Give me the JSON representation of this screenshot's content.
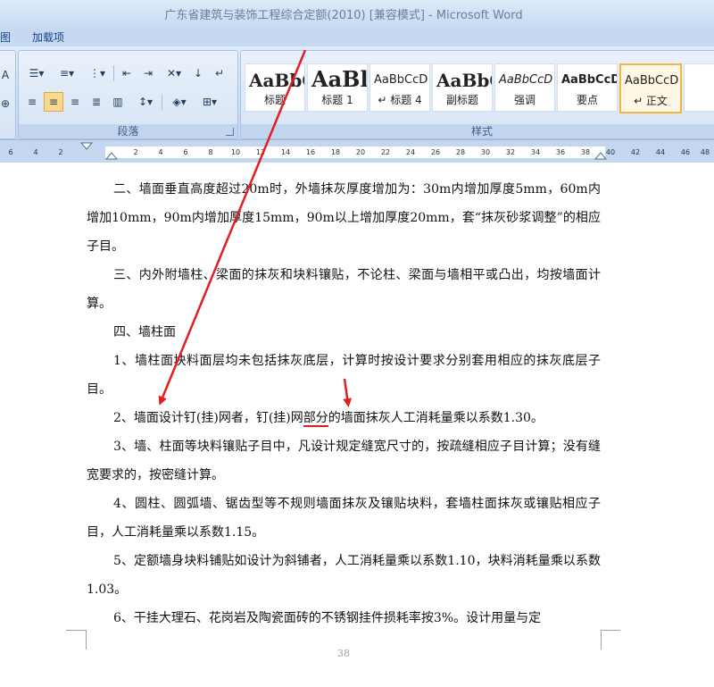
{
  "window": {
    "title": "广东省建筑与装饰工程综合定额(2010) [兼容模式] - Microsoft Word"
  },
  "tabs": [
    {
      "label": "图"
    },
    {
      "label": "加载项"
    }
  ],
  "groups": {
    "paragraph_label": "段落",
    "styles_label": "样式"
  },
  "styles": [
    {
      "sample": "AaBbC",
      "name": "标题"
    },
    {
      "sample": "AaBl",
      "name": "标题 1"
    },
    {
      "sample": "AaBbCcD",
      "name": "↵ 标题 4"
    },
    {
      "sample": "AaBbC",
      "name": "副标题"
    },
    {
      "sample": "AaBbCcD",
      "name": "强调"
    },
    {
      "sample": "AaBbCcD",
      "name": "要点"
    },
    {
      "sample": "AaBbCcD",
      "name": "↵ 正文"
    }
  ],
  "ruler": {
    "ticks": [
      "6",
      "4",
      "2",
      "2",
      "4",
      "6",
      "8",
      "10",
      "12",
      "14",
      "16",
      "18",
      "20",
      "22",
      "24",
      "26",
      "28",
      "30",
      "32",
      "34",
      "36",
      "38",
      "40",
      "42",
      "44",
      "46",
      "48"
    ]
  },
  "document": {
    "paragraphs": [
      "二、墙面垂直高度超过20m时，外墙抹灰厚度增加为：30m内增加厚度5mm，60m内增加10mm，90m内增加厚度15mm，90m以上增加厚度20mm，套“抹灰砂浆调整”的相应子目。",
      "三、内外附墙柱、梁面的抹灰和块料镶贴，不论柱、梁面与墙相平或凸出，均按墙面计算。",
      "四、墙柱面",
      "1、墙柱面块料面层均未包括抹灰底层，计算时按设计要求分别套用相应的抹灰底层子目。",
      "3、墙、柱面等块料镶贴子目中，凡设计规定缝宽尺寸的，按疏缝相应子目计算；没有缝宽要求的，按密缝计算。",
      "4、圆柱、圆弧墙、锯齿型等不规则墙面抹灰及镶贴块料，套墙柱面抹灰或镶贴相应子目，人工消耗量乘以系数1.15。",
      "5、定额墙身块料铺贴如设计为斜铺者，人工消耗量乘以系数1.10，块料消耗量乘以系数1.03。",
      "6、干挂大理石、花岗岩及陶瓷面砖的不锈钢挂件损耗率按3%。设计用量与定"
    ],
    "line2": {
      "before": "2、墙面设计钉(挂)网者，钉(挂)网",
      "highlight": "部分",
      "after": "的墙面抹灰人工消耗量乘以系数1.30。"
    },
    "page_number": "38"
  },
  "colors": {
    "annotation_arrow": "#e02020"
  }
}
